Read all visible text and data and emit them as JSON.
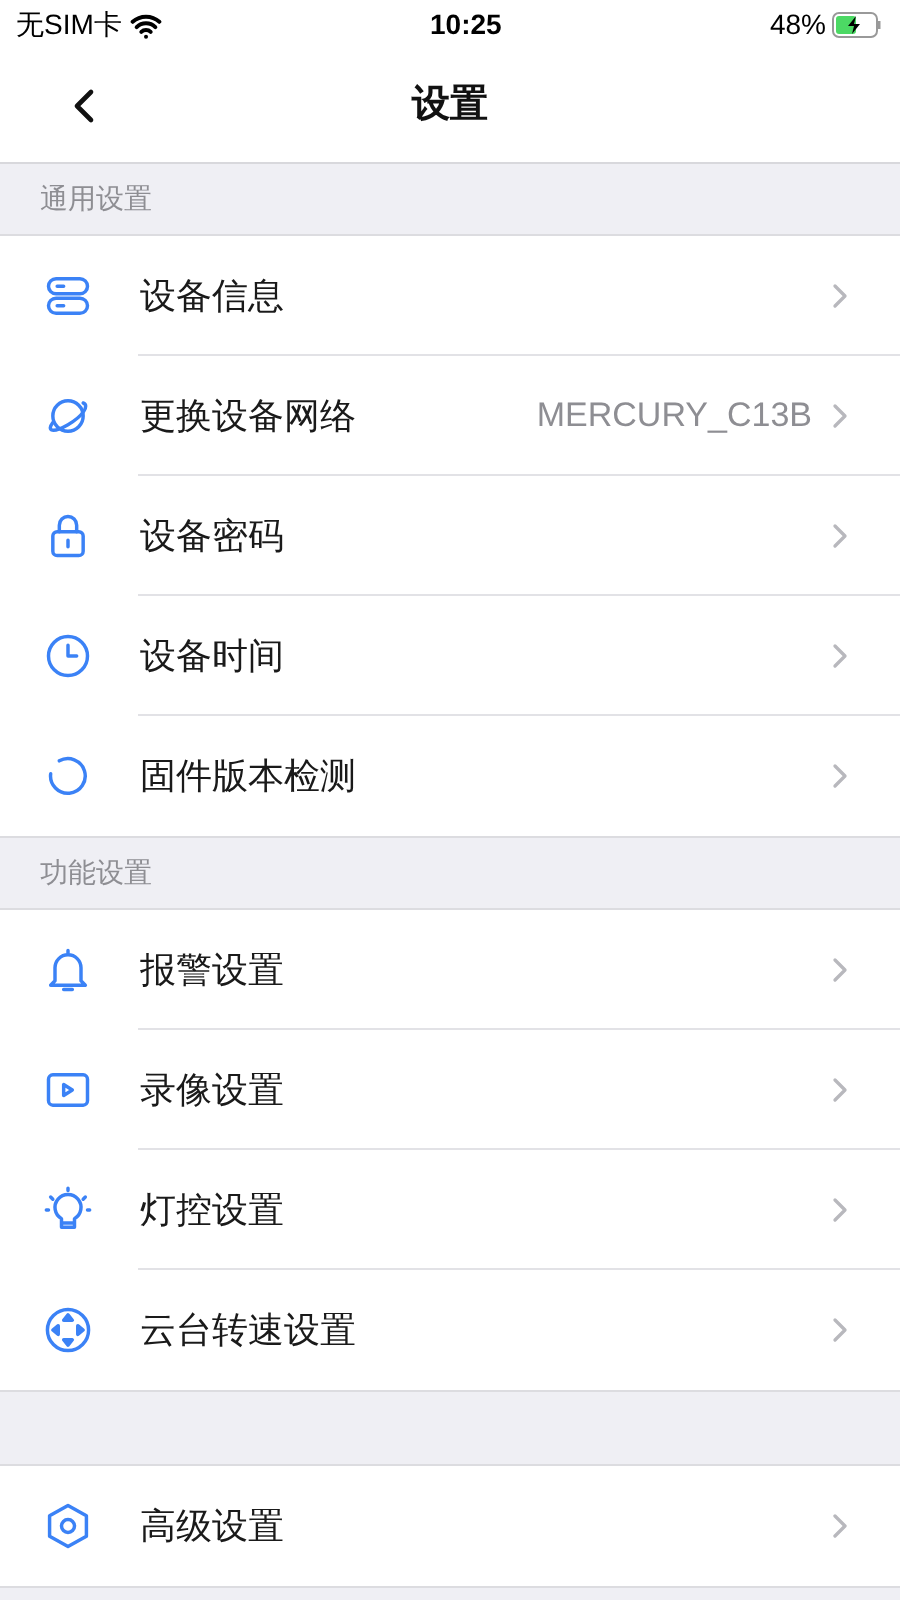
{
  "status_bar": {
    "carrier": "无SIM卡",
    "time": "10:25",
    "battery": "48%"
  },
  "nav": {
    "title": "设置"
  },
  "sections": [
    {
      "title": "通用设置",
      "items": [
        {
          "label": "设备信息"
        },
        {
          "label": "更换设备网络",
          "value": "MERCURY_C13B"
        },
        {
          "label": "设备密码"
        },
        {
          "label": "设备时间"
        },
        {
          "label": "固件版本检测"
        }
      ]
    },
    {
      "title": "功能设置",
      "items": [
        {
          "label": "报警设置"
        },
        {
          "label": "录像设置"
        },
        {
          "label": "灯控设置"
        },
        {
          "label": "云台转速设置"
        }
      ]
    },
    {
      "items": [
        {
          "label": "高级设置"
        }
      ]
    }
  ]
}
